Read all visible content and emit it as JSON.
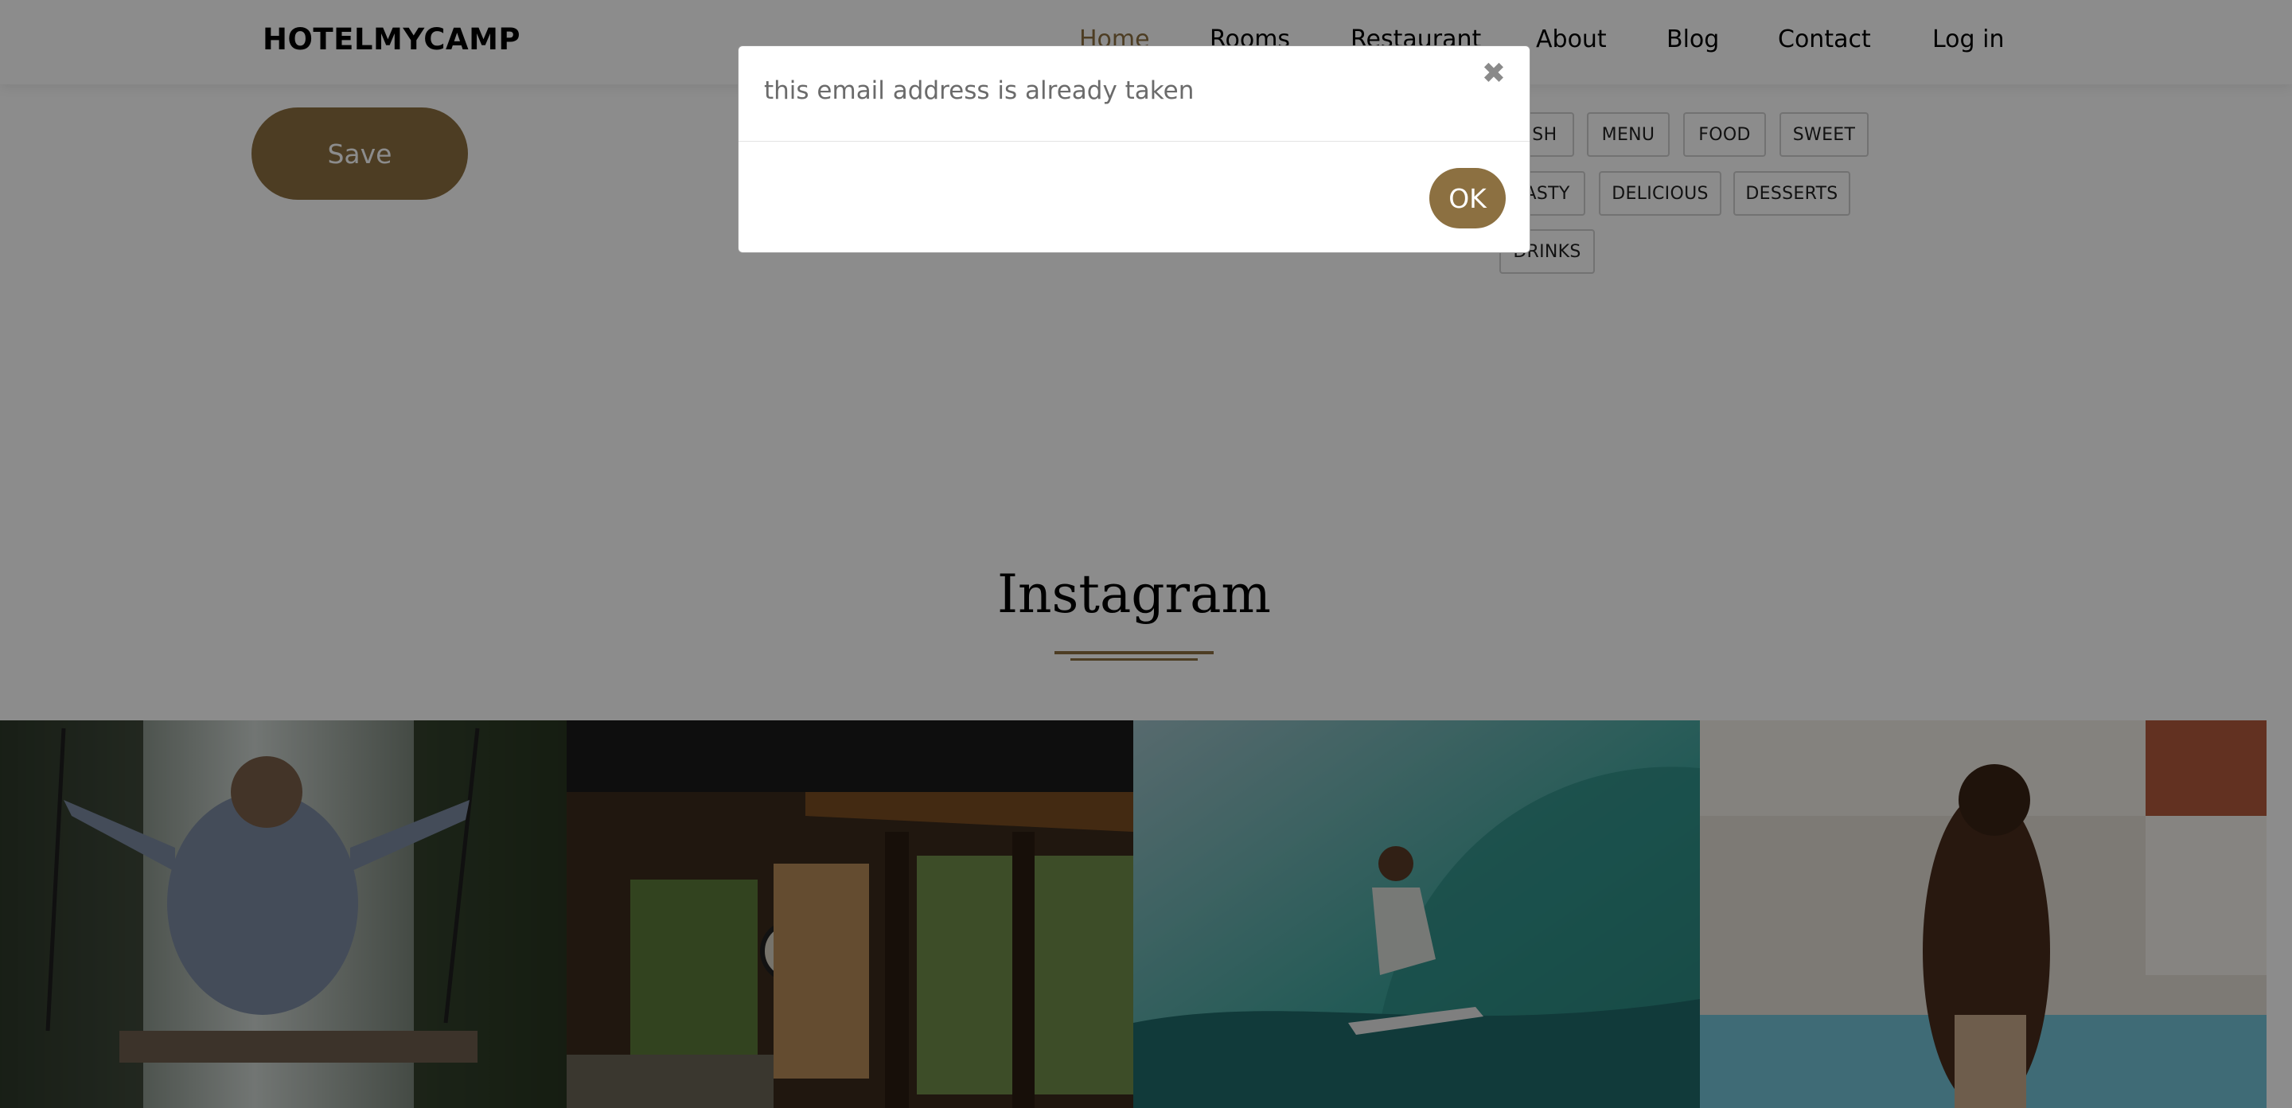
{
  "header": {
    "logo": "HOTELMYCAMP",
    "nav": [
      {
        "label": "Home",
        "active": true
      },
      {
        "label": "Rooms"
      },
      {
        "label": "Restaurant"
      },
      {
        "label": "About"
      },
      {
        "label": "Blog"
      },
      {
        "label": "Contact"
      },
      {
        "label": "Log in"
      }
    ]
  },
  "form": {
    "save_label": "Save"
  },
  "tags": [
    "FISH",
    "MENU",
    "FOOD",
    "SWEET",
    "TASTY",
    "DELICIOUS",
    "DESSERTS",
    "DRINKS"
  ],
  "instagram": {
    "title": "Instagram",
    "photos": [
      "woman-on-swing",
      "porch-interior",
      "surfer-wave",
      "woman-by-pool"
    ]
  },
  "modal": {
    "message": "this email address is already taken",
    "close_icon": "close-icon",
    "ok_label": "OK"
  },
  "colors": {
    "accent": "#8c7041",
    "overlay": "rgba(0,0,0,0.45)"
  }
}
